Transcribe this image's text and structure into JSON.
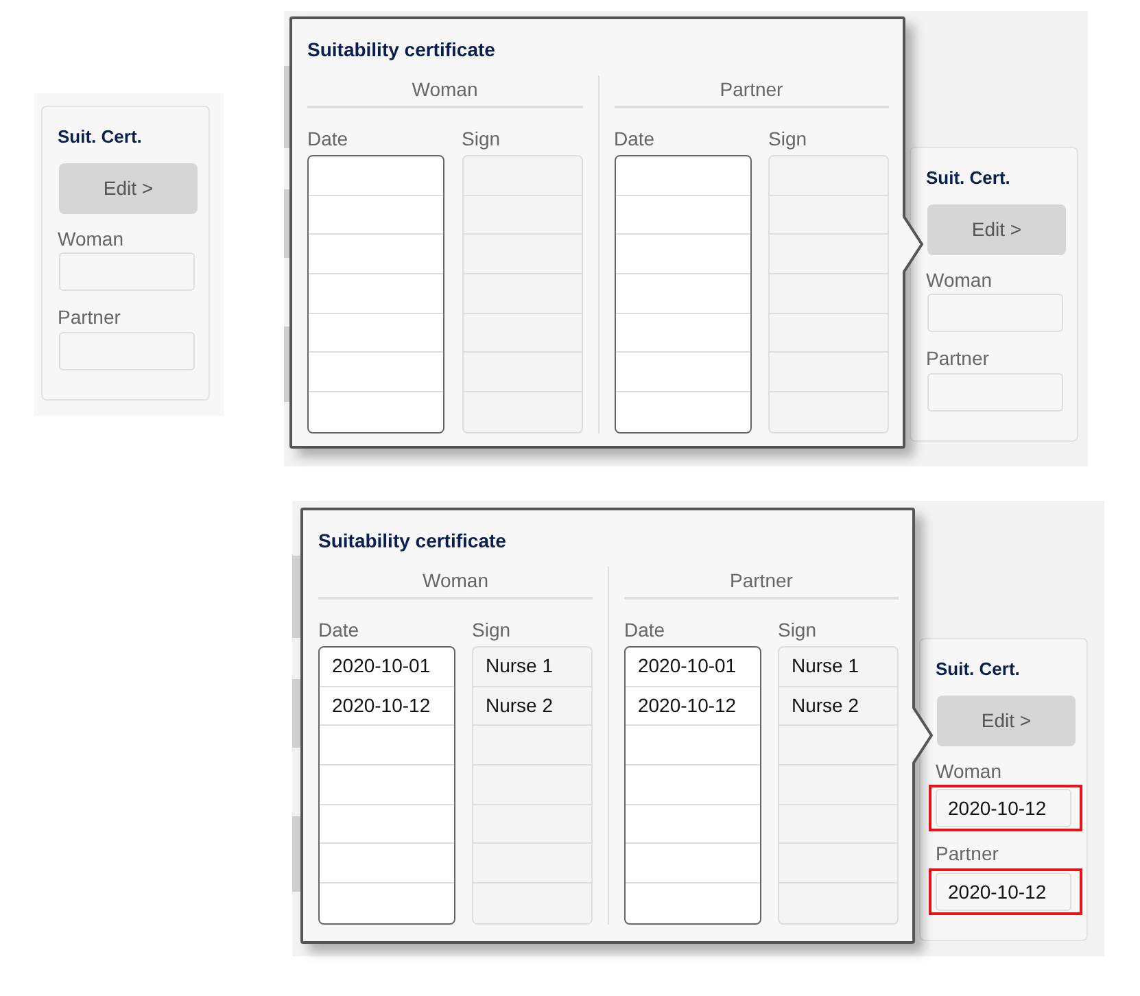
{
  "panels": [
    {
      "kind": "card",
      "card": {
        "title": "Suit. Cert.",
        "button": "Edit >",
        "fields": [
          {
            "label": "Woman",
            "highlighted": false
          },
          {
            "label": "Partner",
            "highlighted": false
          }
        ]
      }
    },
    {
      "kind": "popup",
      "popup": {
        "title": "Suitability certificate",
        "groups": [
          {
            "heading": "Woman",
            "columns": [
              {
                "heading": "Date",
                "kind": "input"
              },
              {
                "heading": "Sign",
                "kind": "readonly"
              }
            ]
          },
          {
            "heading": "Partner",
            "columns": [
              {
                "heading": "Date",
                "kind": "input"
              },
              {
                "heading": "Sign",
                "kind": "readonly"
              }
            ]
          }
        ]
      },
      "card": {
        "title": "Suit. Cert.",
        "button": "Edit >",
        "fields": [
          {
            "label": "Woman",
            "highlighted": false
          },
          {
            "label": "Partner",
            "highlighted": false
          }
        ]
      }
    },
    {
      "kind": "popup",
      "popup": {
        "title": "Suitability certificate",
        "groups": [
          {
            "heading": "Woman",
            "columns": [
              {
                "heading": "Date",
                "kind": "input",
                "cells": [
                  "2020-10-01",
                  "2020-10-12"
                ]
              },
              {
                "heading": "Sign",
                "kind": "readonly",
                "cells": [
                  "Nurse 1",
                  "Nurse 2"
                ]
              }
            ]
          },
          {
            "heading": "Partner",
            "columns": [
              {
                "heading": "Date",
                "kind": "input",
                "cells": [
                  "2020-10-01",
                  "2020-10-12"
                ]
              },
              {
                "heading": "Sign",
                "kind": "readonly",
                "cells": [
                  "Nurse 1",
                  "Nurse 2"
                ]
              }
            ]
          }
        ]
      },
      "card": {
        "title": "Suit. Cert.",
        "button": "Edit >",
        "fields": [
          {
            "label": "Woman",
            "value": "2020-10-12",
            "highlighted": true
          },
          {
            "label": "Partner",
            "value": "2020-10-12",
            "highlighted": true
          }
        ]
      }
    }
  ]
}
